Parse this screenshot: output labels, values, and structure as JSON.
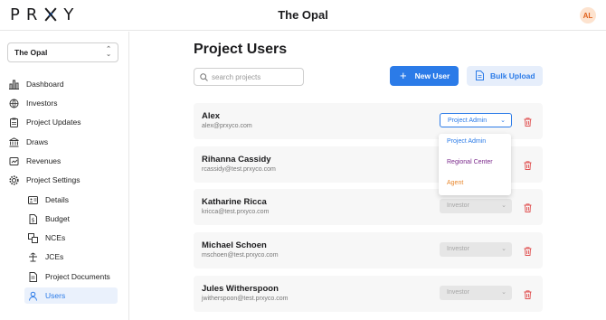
{
  "header": {
    "logo_letters": [
      "P",
      "R",
      "X",
      "Y"
    ],
    "logo_text": "PRXY",
    "project_title": "The Opal",
    "avatar_initials": "AL"
  },
  "sidebar": {
    "project_select": "The Opal",
    "items": [
      {
        "label": "Dashboard",
        "icon": "bar-chart-icon"
      },
      {
        "label": "Investors",
        "icon": "globe-icon"
      },
      {
        "label": "Project Updates",
        "icon": "clipboard-icon"
      },
      {
        "label": "Draws",
        "icon": "bank-icon"
      },
      {
        "label": "Revenues",
        "icon": "revenue-icon"
      },
      {
        "label": "Project Settings",
        "icon": "gear-icon"
      }
    ],
    "sub_items": [
      {
        "label": "Details",
        "icon": "id-card-icon"
      },
      {
        "label": "Budget",
        "icon": "dollar-doc-icon"
      },
      {
        "label": "NCEs",
        "icon": "nce-icon"
      },
      {
        "label": "JCEs",
        "icon": "jce-icon"
      },
      {
        "label": "Project Documents",
        "icon": "document-icon"
      },
      {
        "label": "Users",
        "icon": "user-icon",
        "active": true
      }
    ]
  },
  "main": {
    "title": "Project Users",
    "search_placeholder": "search projects",
    "new_user_label": "New User",
    "bulk_upload_label": "Bulk Upload",
    "users": [
      {
        "name": "Alex",
        "email": "alex@prxyco.com",
        "role": "Project Admin"
      },
      {
        "name": "Rihanna Cassidy",
        "email": "rcassidy@test.prxyco.com",
        "role": ""
      },
      {
        "name": "Katharine Ricca",
        "email": "kricca@test.prxyco.com",
        "role": "Investor"
      },
      {
        "name": "Michael Schoen",
        "email": "mschoen@test.prxyco.com",
        "role": "Investor"
      },
      {
        "name": "Jules Witherspoon",
        "email": "jwitherspoon@test.prxyco.com",
        "role": "Investor"
      }
    ],
    "role_options": [
      {
        "label": "Project Admin",
        "color": "#2b7be8"
      },
      {
        "label": "Regional Center",
        "color": "#7b2a8c"
      },
      {
        "label": "Agent",
        "color": "#e8862b"
      }
    ]
  },
  "colors": {
    "accent": "#2b7be8",
    "danger": "#e05050",
    "avatar_bg": "#fde3cf",
    "avatar_fg": "#e0621d"
  }
}
